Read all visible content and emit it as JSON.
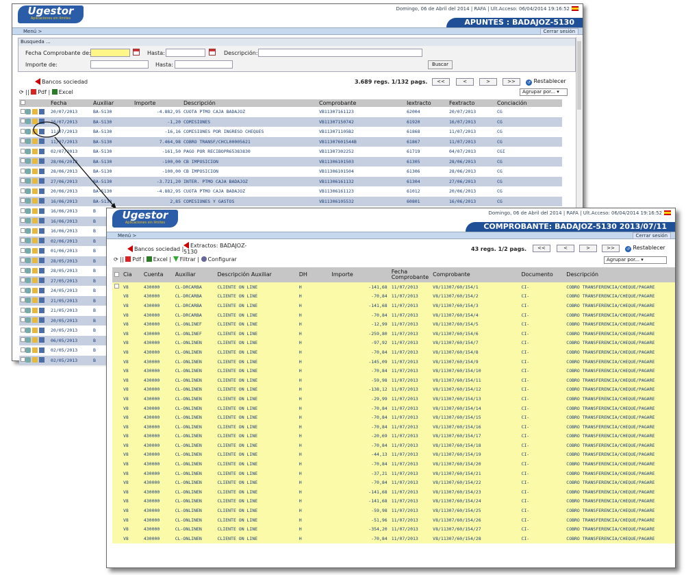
{
  "w1": {
    "app": {
      "logo": "Ugestor",
      "tagline": "Aplicaciones sin límites"
    },
    "header": {
      "date": "Domingo, 06 de Abril del 2014",
      "user": "RAFA",
      "last_access": "Ult.Acceso: 06/04/2014 19:16:52",
      "title": "APUNTES : BADAJOZ-5130"
    },
    "menu": "Menú >",
    "logout": "Cerrar sesión",
    "search": {
      "title": "Busqueda ...",
      "fecha_label": "Fecha Comprobante de:",
      "hasta1": "Hasta:",
      "desc_label": "Descripción:",
      "importe_label": "Importe de:",
      "hasta2": "Hasta:",
      "buscar": "Buscar"
    },
    "toolbar": {
      "bancos": "Bancos sociedad",
      "pdf": "Pdf",
      "excel": "Excel",
      "count": "3.689 regs. 1/132 pags.",
      "first": "<<",
      "prev": "<",
      "next": ">",
      "last": ">>",
      "restablecer": "Restablecer",
      "agrupar": "Agrupar por..."
    },
    "columns": [
      "",
      "Fecha",
      "Auxiliar",
      "Importe",
      "Descripción",
      "Comprobante",
      "Iextracto",
      "Fextracto",
      "Conciación"
    ],
    "rows": [
      [
        "20/07/2013",
        "BA-5130",
        "-4.882,95",
        "CUOTA PTMO CAJA BADAJOZ",
        "VB11307161123",
        "62004",
        "20/07/2013",
        "CG"
      ],
      [
        "16/07/2013",
        "BA-5130",
        "-1,20",
        "COMISIONES",
        "VB11307150742",
        "61920",
        "16/07/2013",
        "CG"
      ],
      [
        "11/07/2013",
        "BA-5130",
        "-16,16",
        "COMISIONES POR INGRESO CHEQUES",
        "VB113071105B2",
        "61868",
        "11/07/2013",
        "CG"
      ],
      [
        "11/07/2013",
        "BA-5130",
        "7.464,98",
        "COBRO TRANSF/CHCL00005621",
        "VB11307601544B",
        "61867",
        "11/07/2013",
        "CG"
      ],
      [
        "02/07/2013",
        "BA-5130",
        "-161,50",
        "PAGO POR RECIBOPR65383830",
        "VB11307302252",
        "61719",
        "04/07/2013",
        "CGI"
      ],
      [
        "28/06/2013",
        "BA-5130",
        "-100,00",
        "CB IMPOSICION",
        "VB11306101503",
        "61305",
        "28/06/2013",
        "CG"
      ],
      [
        "28/06/2013",
        "BA-5130",
        "-100,00",
        "CB IMPOSICION",
        "VB11306101504",
        "61306",
        "28/06/2013",
        "CG"
      ],
      [
        "27/06/2013",
        "BA-5130",
        "-3.721,20",
        "INTER. PTMO CAJA BADAJOZ",
        "VB11306161132",
        "61304",
        "27/06/2013",
        "CG"
      ],
      [
        "20/06/2013",
        "BA-5130",
        "-4.882,95",
        "CUOTA PTMO CAJA BADAJOZ",
        "VB11306161123",
        "61012",
        "20/06/2013",
        "CG"
      ],
      [
        "16/06/2013",
        "BA-5130",
        "2,85",
        "COMISIONES Y GASTOS",
        "VB11306105532",
        "60801",
        "16/06/2013",
        "CG"
      ],
      [
        "16/06/2013",
        "B",
        "",
        "",
        "",
        "",
        "",
        ""
      ],
      [
        "16/06/2013",
        "B",
        "",
        "",
        "",
        "",
        "",
        ""
      ],
      [
        "16/06/2013",
        "B",
        "",
        "",
        "",
        "",
        "",
        ""
      ],
      [
        "02/06/2013",
        "B",
        "",
        "",
        "",
        "",
        "",
        ""
      ],
      [
        "01/06/2013",
        "B",
        "",
        "",
        "",
        "",
        "",
        ""
      ],
      [
        "28/05/2013",
        "B",
        "",
        "",
        "",
        "",
        "",
        ""
      ],
      [
        "28/05/2013",
        "B",
        "",
        "",
        "",
        "",
        "",
        ""
      ],
      [
        "27/05/2013",
        "B",
        "",
        "",
        "",
        "",
        "",
        ""
      ],
      [
        "24/05/2013",
        "B",
        "",
        "",
        "",
        "",
        "",
        ""
      ],
      [
        "21/05/2013",
        "B",
        "",
        "",
        "",
        "",
        "",
        ""
      ],
      [
        "21/05/2013",
        "B",
        "",
        "",
        "",
        "",
        "",
        ""
      ],
      [
        "20/05/2013",
        "B",
        "",
        "",
        "",
        "",
        "",
        ""
      ],
      [
        "20/05/2013",
        "B",
        "",
        "",
        "",
        "",
        "",
        ""
      ],
      [
        "06/05/2013",
        "B",
        "",
        "",
        "",
        "",
        "",
        ""
      ],
      [
        "02/05/2013",
        "B",
        "",
        "",
        "",
        "",
        "",
        ""
      ],
      [
        "02/05/2013",
        "B",
        "",
        "",
        "",
        "",
        "",
        ""
      ]
    ]
  },
  "w2": {
    "app": {
      "logo": "Ugestor",
      "tagline": "Aplicaciones sin límites"
    },
    "header": {
      "date": "Domingo, 06 de Abril del 2014",
      "user": "RAFA",
      "last_access": "Ult.Acceso: 06/04/2014 19:16:52",
      "title": "COMPROBANTE: BADAJOZ-5130 2013/07/11"
    },
    "menu": "Menú >",
    "logout": "Cerrar sesión",
    "toolbar": {
      "bancos": "Bancos sociedad",
      "extractos": "Extractos: BADAJOZ-5130",
      "pdf": "Pdf",
      "excel": "Excel",
      "filtrar": "Filtrar",
      "configurar": "Configurar",
      "count": "43 regs. 1/2 pags.",
      "first": "<<",
      "prev": "<",
      "next": ">",
      "last": ">>",
      "restablecer": "Restablecer",
      "agrupar": "Agrupar por..."
    },
    "columns": [
      "",
      "Cia",
      "Cuenta",
      "Auxiliar",
      "Descripción Auxiliar",
      "DH",
      "Importe",
      "Fecha Comprobante",
      "Comprobante",
      "Documento",
      "Descripción"
    ],
    "rows": [
      [
        "V8",
        "430000",
        "CL-DRCARBA",
        "CLIENTE ON LINE",
        "H",
        "-141,68",
        "11/07/2013",
        "V8/11307/60/154/1",
        "CI-",
        "COBRO TRANSFERENCIA/CHEQUE/PAGARE"
      ],
      [
        "V8",
        "430000",
        "CL-DRCARBA",
        "CLIENTE ON LINE",
        "H",
        "-70,84",
        "11/07/2013",
        "V8/11307/60/154/2",
        "CI-",
        "COBRO TRANSFERENCIA/CHEQUE/PAGARE"
      ],
      [
        "V8",
        "430000",
        "CL-DRCARBA",
        "CLIENTE ON LINE",
        "H",
        "-141,68",
        "11/07/2013",
        "V8/11307/60/154/3",
        "CI-",
        "COBRO TRANSFERENCIA/CHEQUE/PAGARE"
      ],
      [
        "V8",
        "430000",
        "CL-DRCARBA",
        "CLIENTE ON LINE",
        "H",
        "-70,84",
        "11/07/2013",
        "V8/11307/60/154/4",
        "CI-",
        "COBRO TRANSFERENCIA/CHEQUE/PAGARE"
      ],
      [
        "V8",
        "430000",
        "CL-ONLINEF",
        "CLIENTE ON LINE",
        "H",
        "-12,99",
        "11/07/2013",
        "V8/11307/60/154/5",
        "CI-",
        "COBRO TRANSFERENCIA/CHEQUE/PAGARE"
      ],
      [
        "V8",
        "430000",
        "CL-ONLINEF",
        "CLIENTE ON LINE",
        "H",
        "-259,80",
        "11/07/2013",
        "V8/11307/60/154/6",
        "CI-",
        "COBRO TRANSFERENCIA/CHEQUE/PAGARE"
      ],
      [
        "V8",
        "430000",
        "CL-ONLINEN",
        "CLIENTE ON LINE",
        "H",
        "-97,92",
        "11/07/2013",
        "V8/11307/60/154/7",
        "CI-",
        "COBRO TRANSFERENCIA/CHEQUE/PAGARE"
      ],
      [
        "V8",
        "430000",
        "CL-ONLINEN",
        "CLIENTE ON LINE",
        "H",
        "-70,84",
        "11/07/2013",
        "V8/11307/60/154/8",
        "CI-",
        "COBRO TRANSFERENCIA/CHEQUE/PAGARE"
      ],
      [
        "V8",
        "430000",
        "CL-ONLINEN",
        "CLIENTE ON LINE",
        "H",
        "-145,09",
        "11/07/2013",
        "V8/11307/60/154/9",
        "CI-",
        "COBRO TRANSFERENCIA/CHEQUE/PAGARE"
      ],
      [
        "V8",
        "430000",
        "CL-ONLINEN",
        "CLIENTE ON LINE",
        "H",
        "-70,84",
        "11/07/2013",
        "V8/11307/60/154/10",
        "CI-",
        "COBRO TRANSFERENCIA/CHEQUE/PAGARE"
      ],
      [
        "V8",
        "430000",
        "CL-ONLINEN",
        "CLIENTE ON LINE",
        "H",
        "-59,98",
        "11/07/2013",
        "V8/11307/60/154/11",
        "CI-",
        "COBRO TRANSFERENCIA/CHEQUE/PAGARE"
      ],
      [
        "V8",
        "430000",
        "CL-ONLINEN",
        "CLIENTE ON LINE",
        "H",
        "-138,12",
        "11/07/2013",
        "V8/11307/60/154/12",
        "CI-",
        "COBRO TRANSFERENCIA/CHEQUE/PAGARE"
      ],
      [
        "V8",
        "430000",
        "CL-ONLINEN",
        "CLIENTE ON LINE",
        "H",
        "-29,99",
        "11/07/2013",
        "V8/11307/60/154/13",
        "CI-",
        "COBRO TRANSFERENCIA/CHEQUE/PAGARE"
      ],
      [
        "V8",
        "430000",
        "CL-ONLINEN",
        "CLIENTE ON LINE",
        "H",
        "-70,84",
        "11/07/2013",
        "V8/11307/60/154/14",
        "CI-",
        "COBRO TRANSFERENCIA/CHEQUE/PAGARE"
      ],
      [
        "V8",
        "430000",
        "CL-ONLINEN",
        "CLIENTE ON LINE",
        "H",
        "-70,84",
        "11/07/2013",
        "V8/11307/60/154/15",
        "CI-",
        "COBRO TRANSFERENCIA/CHEQUE/PAGARE"
      ],
      [
        "V8",
        "430000",
        "CL-ONLINEN",
        "CLIENTE ON LINE",
        "H",
        "-70,84",
        "11/07/2013",
        "V8/11307/60/154/16",
        "CI-",
        "COBRO TRANSFERENCIA/CHEQUE/PAGARE"
      ],
      [
        "V8",
        "430000",
        "CL-ONLINEN",
        "CLIENTE ON LINE",
        "H",
        "-20,69",
        "11/07/2013",
        "V8/11307/60/154/17",
        "CI-",
        "COBRO TRANSFERENCIA/CHEQUE/PAGARE"
      ],
      [
        "V8",
        "430000",
        "CL-ONLINEN",
        "CLIENTE ON LINE",
        "H",
        "-70,84",
        "11/07/2013",
        "V8/11307/60/154/18",
        "CI-",
        "COBRO TRANSFERENCIA/CHEQUE/PAGARE"
      ],
      [
        "V8",
        "430000",
        "CL-ONLINEN",
        "CLIENTE ON LINE",
        "H",
        "-44,13",
        "11/07/2013",
        "V8/11307/60/154/19",
        "CI-",
        "COBRO TRANSFERENCIA/CHEQUE/PAGARE"
      ],
      [
        "V8",
        "430000",
        "CL-ONLINEN",
        "CLIENTE ON LINE",
        "H",
        "-70,84",
        "11/07/2013",
        "V8/11307/60/154/20",
        "CI-",
        "COBRO TRANSFERENCIA/CHEQUE/PAGARE"
      ],
      [
        "V8",
        "430000",
        "CL-ONLINEN",
        "CLIENTE ON LINE",
        "H",
        "-37,21",
        "11/07/2013",
        "V8/11307/60/154/21",
        "CI-",
        "COBRO TRANSFERENCIA/CHEQUE/PAGARE"
      ],
      [
        "V8",
        "430000",
        "CL-ONLINEN",
        "CLIENTE ON LINE",
        "H",
        "-70,84",
        "11/07/2013",
        "V8/11307/60/154/22",
        "CI-",
        "COBRO TRANSFERENCIA/CHEQUE/PAGARE"
      ],
      [
        "V8",
        "430000",
        "CL-ONLINEN",
        "CLIENTE ON LINE",
        "H",
        "-141,68",
        "11/07/2013",
        "V8/11307/60/154/23",
        "CI-",
        "COBRO TRANSFERENCIA/CHEQUE/PAGARE"
      ],
      [
        "V8",
        "430000",
        "CL-ONLINEN",
        "CLIENTE ON LINE",
        "H",
        "-141,68",
        "11/07/2013",
        "V8/11307/60/154/24",
        "CI-",
        "COBRO TRANSFERENCIA/CHEQUE/PAGARE"
      ],
      [
        "V8",
        "430000",
        "CL-ONLINEN",
        "CLIENTE ON LINE",
        "H",
        "-59,98",
        "11/07/2013",
        "V8/11307/60/154/25",
        "CI-",
        "COBRO TRANSFERENCIA/CHEQUE/PAGARE"
      ],
      [
        "V8",
        "430000",
        "CL-ONLINEN",
        "CLIENTE ON LINE",
        "H",
        "-51,96",
        "11/07/2013",
        "V8/11307/60/154/26",
        "CI-",
        "COBRO TRANSFERENCIA/CHEQUE/PAGARE"
      ],
      [
        "V8",
        "430000",
        "CL-ONLINEN",
        "CLIENTE ON LINE",
        "H",
        "-354,20",
        "11/07/2013",
        "V8/11307/60/154/27",
        "CI-",
        "COBRO TRANSFERENCIA/CHEQUE/PAGARE"
      ],
      [
        "V8",
        "430000",
        "CL-ONLINEN",
        "CLIENTE ON LINE",
        "H",
        "-70,84",
        "11/07/2013",
        "V8/11307/60/154/28",
        "CI-",
        "COBRO TRANSFERENCIA/CHEQUE/PAGARE"
      ]
    ]
  }
}
